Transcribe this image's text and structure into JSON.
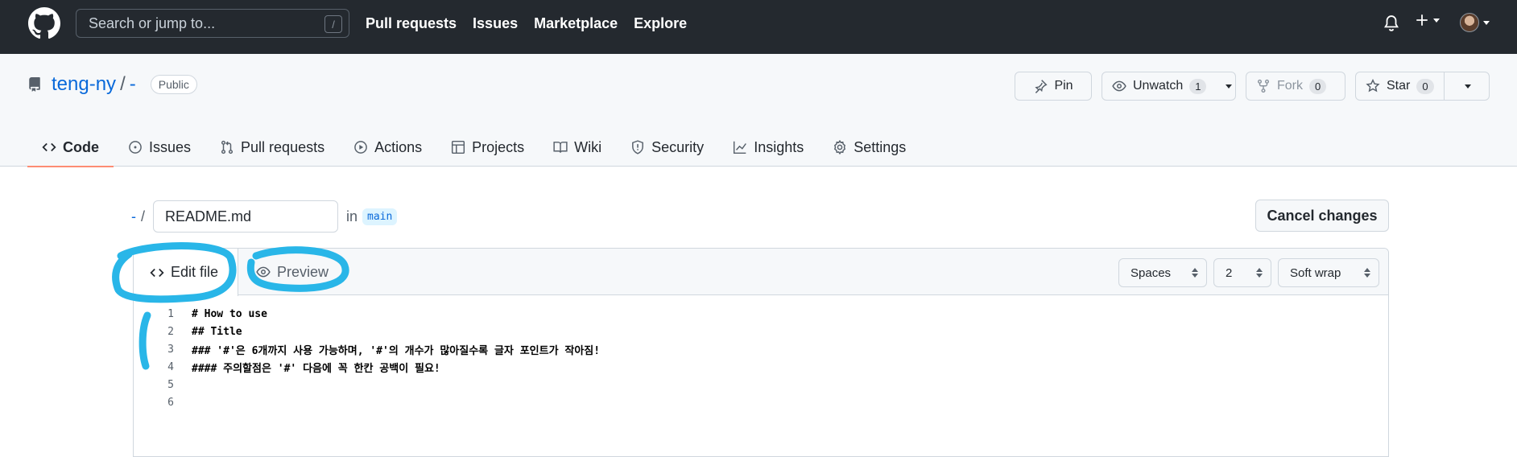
{
  "header": {
    "search_placeholder": "Search or jump to...",
    "search_shortcut": "/",
    "nav": [
      "Pull requests",
      "Issues",
      "Marketplace",
      "Explore"
    ]
  },
  "repo": {
    "owner": "teng-ny",
    "separator": "/",
    "name": "-",
    "visibility": "Public",
    "pin_label": "Pin",
    "watch_label": "Unwatch",
    "watch_count": "1",
    "fork_label": "Fork",
    "fork_count": "0",
    "star_label": "Star",
    "star_count": "0"
  },
  "tabs": [
    {
      "label": "Code",
      "icon": "code-icon"
    },
    {
      "label": "Issues",
      "icon": "issue-icon"
    },
    {
      "label": "Pull requests",
      "icon": "pull-request-icon"
    },
    {
      "label": "Actions",
      "icon": "play-icon"
    },
    {
      "label": "Projects",
      "icon": "table-icon"
    },
    {
      "label": "Wiki",
      "icon": "book-icon"
    },
    {
      "label": "Security",
      "icon": "shield-icon"
    },
    {
      "label": "Insights",
      "icon": "graph-icon"
    },
    {
      "label": "Settings",
      "icon": "gear-icon"
    }
  ],
  "edit": {
    "path_root": "-",
    "path_sep": "/",
    "filename": "README.md",
    "in_label": "in",
    "branch": "main",
    "cancel_label": "Cancel changes",
    "tab_edit": "Edit file",
    "tab_preview": "Preview",
    "indent_mode": "Spaces",
    "indent_size": "2",
    "wrap_mode": "Soft wrap"
  },
  "code_lines": [
    {
      "n": "1",
      "text": "# How to use"
    },
    {
      "n": "2",
      "text": "## Title"
    },
    {
      "n": "3",
      "text": "### '#'은 6개까지 사용 가능하며, '#'의 개수가 많아질수록 글자 포인트가 작아짐!"
    },
    {
      "n": "4",
      "text": "#### 주의할점은 '#' 다음에 꼭 한칸 공백이 필요!"
    },
    {
      "n": "5",
      "text": ""
    },
    {
      "n": "6",
      "text": ""
    }
  ],
  "colors": {
    "header_bg": "#24292f",
    "link": "#0969da",
    "tab_underline": "#fd8c73",
    "annotation": "#29b6e8"
  }
}
